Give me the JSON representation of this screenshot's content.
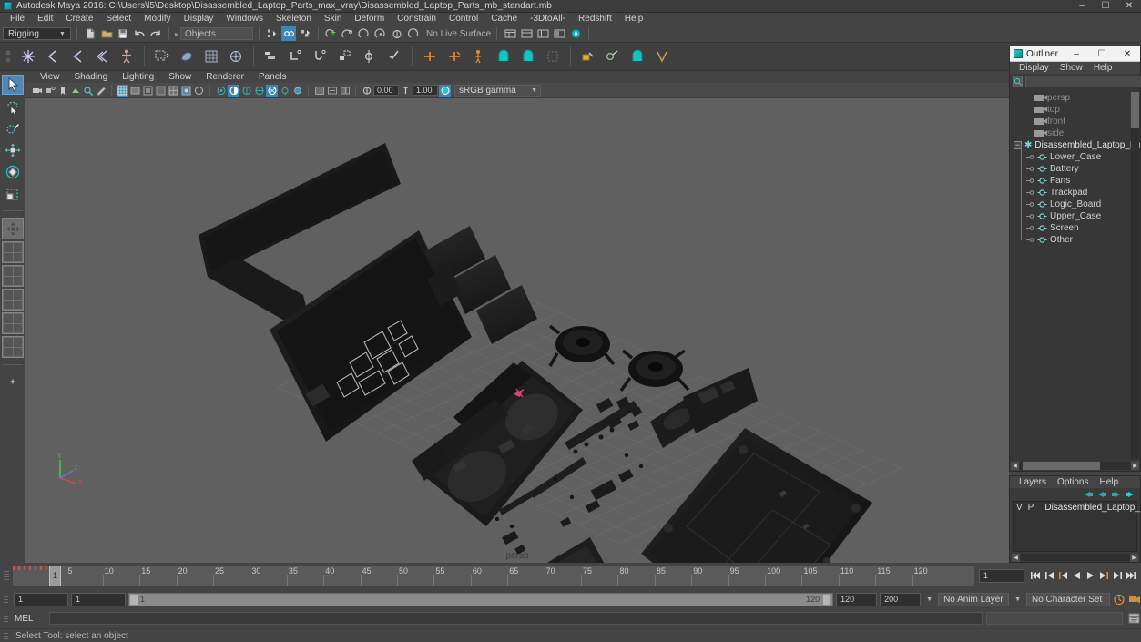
{
  "window": {
    "title": "Autodesk Maya 2016: C:\\Users\\l5\\Desktop\\Disassembled_Laptop_Parts_max_vray\\Disassembled_Laptop_Parts_mb_standart.mb",
    "minimize": "–",
    "maximize": "☐",
    "close": "✕"
  },
  "menubar": {
    "items": [
      "File",
      "Edit",
      "Create",
      "Select",
      "Modify",
      "Display",
      "Windows",
      "Skeleton",
      "Skin",
      "Deform",
      "Constrain",
      "Control",
      "Cache",
      "-3DtoAll-",
      "Redshift",
      "Help"
    ]
  },
  "statusline": {
    "menu_set": "Rigging",
    "object_field_placeholder": "Objects",
    "live_surface_label": "No Live Surface",
    "icons": [
      "new-scene-icon",
      "open-scene-icon",
      "save-scene-icon",
      "undo-icon",
      "redo-icon",
      "select-hierarchy-icon",
      "select-object-icon",
      "select-component-icon",
      "snap-grid-icon",
      "snap-curve-icon",
      "snap-point-icon",
      "snap-projected-center-icon",
      "snap-view-plane-icon",
      "make-live-icon",
      "show-attribute-editor-icon",
      "show-tool-settings-icon",
      "show-channel-box-icon",
      "show-layer-editor-icon",
      "render-view-icon"
    ]
  },
  "shelf": {
    "icons": [
      "joint-tool-icon",
      "ik-handle-icon",
      "ik-spline-icon",
      "ik-spring-icon",
      "quick-rig-icon",
      "skin-bind-icon",
      "paint-weights-icon",
      "interactive-bind-icon",
      "lattice-icon",
      "cluster-icon",
      "nonlinear-bend-icon",
      "nonlinear-flare-icon",
      "nonlinear-sine-icon",
      "nonlinear-squash-icon",
      "nonlinear-twist-icon",
      "nonlinear-wave-icon",
      "parent-constraint-icon",
      "point-constraint-icon",
      "orient-constraint-icon",
      "scale-constraint-icon",
      "aim-constraint-icon",
      "pole-vector-icon",
      "pose-deformer-icon",
      "blendshape-icon",
      "delta-mush-icon",
      "wrap-icon"
    ]
  },
  "toolbox": {
    "tools": [
      {
        "name": "select-tool",
        "active": true
      },
      {
        "name": "lasso-select-tool",
        "active": false
      },
      {
        "name": "paint-select-tool",
        "active": false
      },
      {
        "name": "move-tool",
        "active": false
      },
      {
        "name": "rotate-tool",
        "active": false
      },
      {
        "name": "scale-tool",
        "active": false
      }
    ],
    "layouts": [
      "single-pane-layout",
      "four-pane-layout",
      "two-pane-layout",
      "three-pane-layout"
    ]
  },
  "viewport_panel": {
    "menu": [
      "View",
      "Shading",
      "Lighting",
      "Show",
      "Renderer",
      "Panels"
    ],
    "exposure_value": "0.00",
    "gamma_value": "1.00",
    "color_profile": "sRGB gamma",
    "camera_label": "persp",
    "icons": [
      "select-camera-icon",
      "camera-attributes-icon",
      "bookmark-icon",
      "image-plane-icon",
      "2d-pan-zoom-icon",
      "grease-pencil-icon",
      "wireframe-icon",
      "smooth-shade-all-icon",
      "smooth-shade-selected-icon",
      "flat-shade-icon",
      "wireframe-on-shaded-icon",
      "texture-icon",
      "use-default-light-icon",
      "use-all-lights-icon",
      "shadows-icon",
      "screen-space-ao-icon",
      "motion-blur-icon",
      "multisample-icon",
      "depth-of-field-icon",
      "isolate-select-icon",
      "xray-icon",
      "xray-joints-icon",
      "xray-active-components-icon",
      "exposure-icon",
      "gamma-icon",
      "color-management-icon"
    ]
  },
  "outliner": {
    "title": "Outliner",
    "menu": [
      "Display",
      "Show",
      "Help"
    ],
    "search_value": "",
    "search_placeholder": "",
    "rows": [
      {
        "label": "persp",
        "type": "camera",
        "depth": 1,
        "dim": true
      },
      {
        "label": "top",
        "type": "camera",
        "depth": 1,
        "dim": true
      },
      {
        "label": "front",
        "type": "camera",
        "depth": 1,
        "dim": true
      },
      {
        "label": "side",
        "type": "camera",
        "depth": 1,
        "dim": true
      },
      {
        "label": "Disassembled_Laptop_Parts",
        "type": "group",
        "depth": 0,
        "dim": false,
        "expanded": true
      },
      {
        "label": "Lower_Case",
        "type": "mesh",
        "depth": 1,
        "dim": false
      },
      {
        "label": "Battery",
        "type": "mesh",
        "depth": 1,
        "dim": false
      },
      {
        "label": "Fans",
        "type": "mesh",
        "depth": 1,
        "dim": false
      },
      {
        "label": "Trackpad",
        "type": "mesh",
        "depth": 1,
        "dim": false
      },
      {
        "label": "Logic_Board",
        "type": "mesh",
        "depth": 1,
        "dim": false
      },
      {
        "label": "Upper_Case",
        "type": "mesh",
        "depth": 1,
        "dim": false
      },
      {
        "label": "Screen",
        "type": "mesh",
        "depth": 1,
        "dim": false
      },
      {
        "label": "Other",
        "type": "mesh",
        "depth": 1,
        "dim": false
      }
    ],
    "expand_symbol": "−"
  },
  "layer_editor": {
    "menu": [
      "Layers",
      "Options",
      "Help"
    ],
    "column_v": "V",
    "column_p": "P",
    "layers": [
      {
        "name": "Disassembled_Laptop_",
        "color": "#e01010",
        "visible": "",
        "playback": ""
      }
    ],
    "buttons": [
      "create-empty-layer-icon",
      "create-layer-from-selected-icon",
      "select-objects-in-layer-icon",
      "move-layer-icon"
    ]
  },
  "timeslider": {
    "ticks": [
      5,
      10,
      15,
      20,
      25,
      30,
      35,
      40,
      45,
      50,
      55,
      60,
      65,
      70,
      75,
      80,
      85,
      90,
      95,
      100,
      105,
      110,
      115,
      120
    ],
    "current_frame": "1",
    "frame_field": "1",
    "playback_buttons": [
      "go-to-start-icon",
      "step-back-keyframe-icon",
      "step-back-frame-icon",
      "play-backwards-icon",
      "play-forwards-icon",
      "step-forward-frame-icon",
      "step-forward-keyframe-icon",
      "go-to-end-icon"
    ]
  },
  "rangeslider": {
    "anim_start": "1",
    "range_start": "1",
    "bar_start_label": "1",
    "bar_end_label": "120",
    "range_end": "120",
    "anim_end": "200",
    "anim_layer": "No Anim Layer",
    "character_set": "No Character Set",
    "icons": [
      "auto-keyframe-icon",
      "animation-preferences-icon"
    ]
  },
  "commandline": {
    "label": "MEL",
    "input_value": "",
    "input_placeholder": "",
    "script-editor-button": "script-editor-icon"
  },
  "helpline": {
    "text": "Select Tool: select an object"
  },
  "colors": {
    "accent": "#3c86b5",
    "viewport_bg": "#606060",
    "panel_bg": "#444444",
    "layer_color": "#e01010"
  }
}
